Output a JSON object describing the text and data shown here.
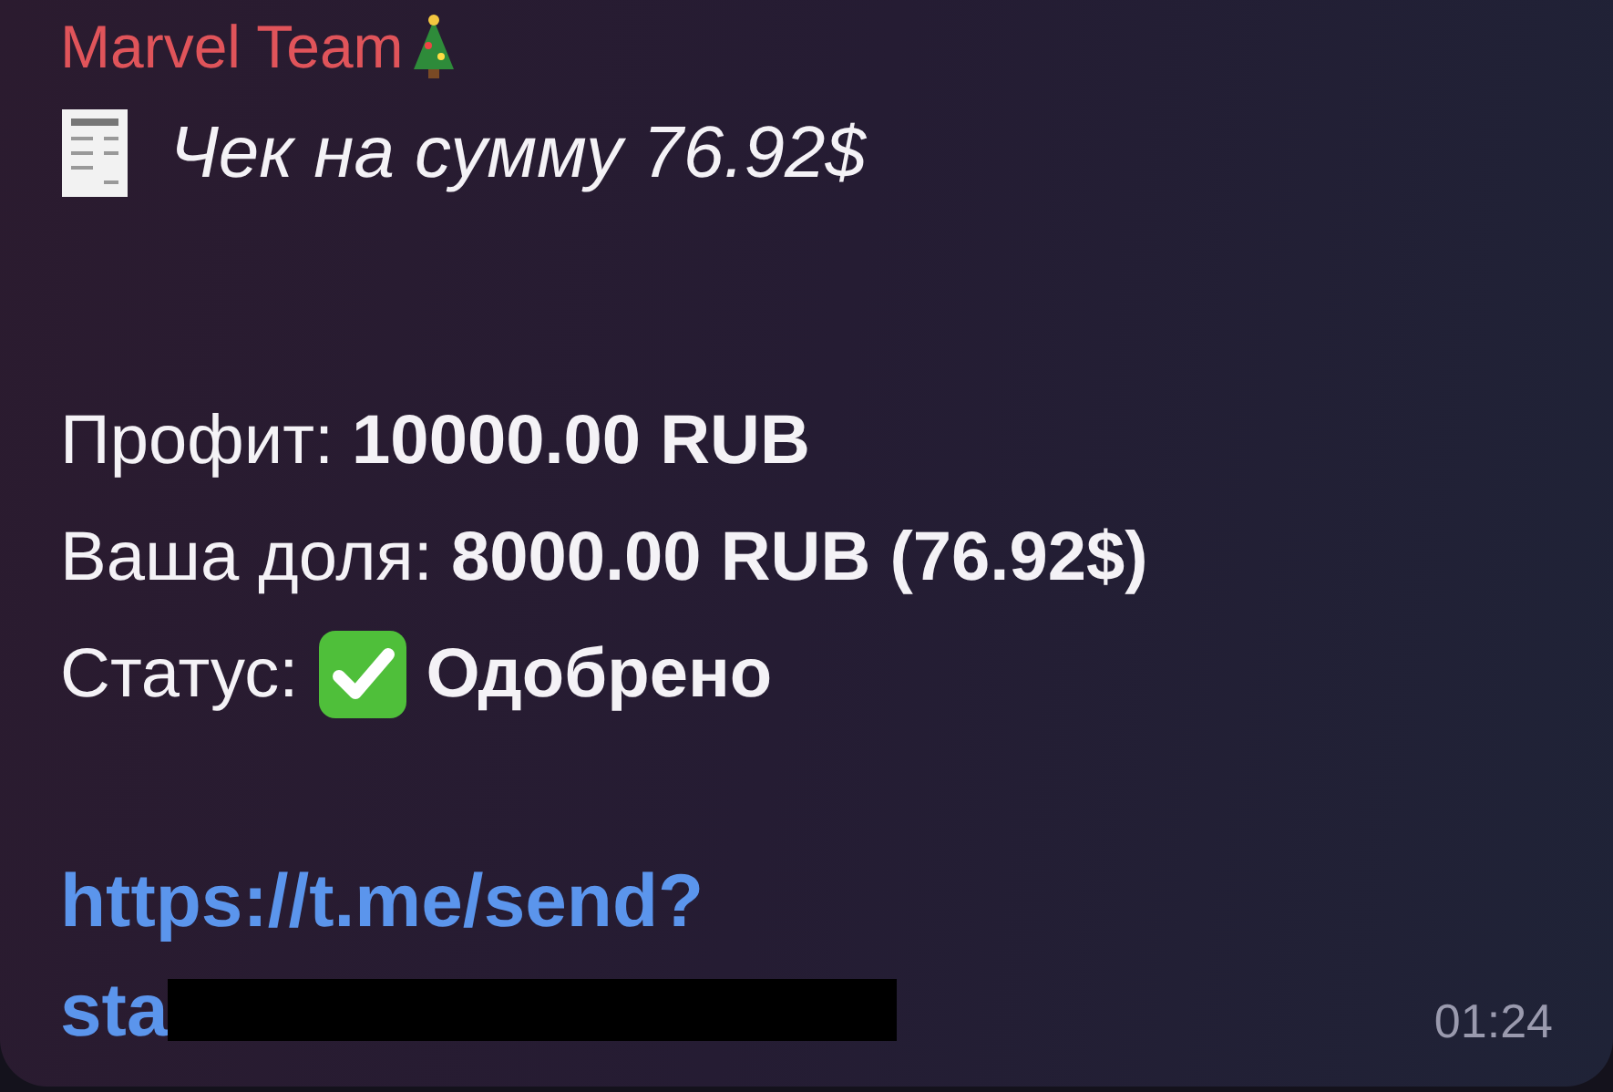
{
  "message": {
    "sender": "Marvel Team",
    "title": "Чек на сумму 76.92$",
    "fields": [
      {
        "kind": "text",
        "label": "Профит:",
        "value": "10000.00 RUB"
      },
      {
        "kind": "text",
        "label": "Ваша доля:",
        "value": "8000.00 RUB (76.92$)"
      },
      {
        "kind": "status",
        "label": "Статус:",
        "value": "Одобрено"
      }
    ],
    "link_lines": [
      "https://t.me/send?",
      "sta"
    ],
    "redacted": true,
    "time": "01:24"
  }
}
